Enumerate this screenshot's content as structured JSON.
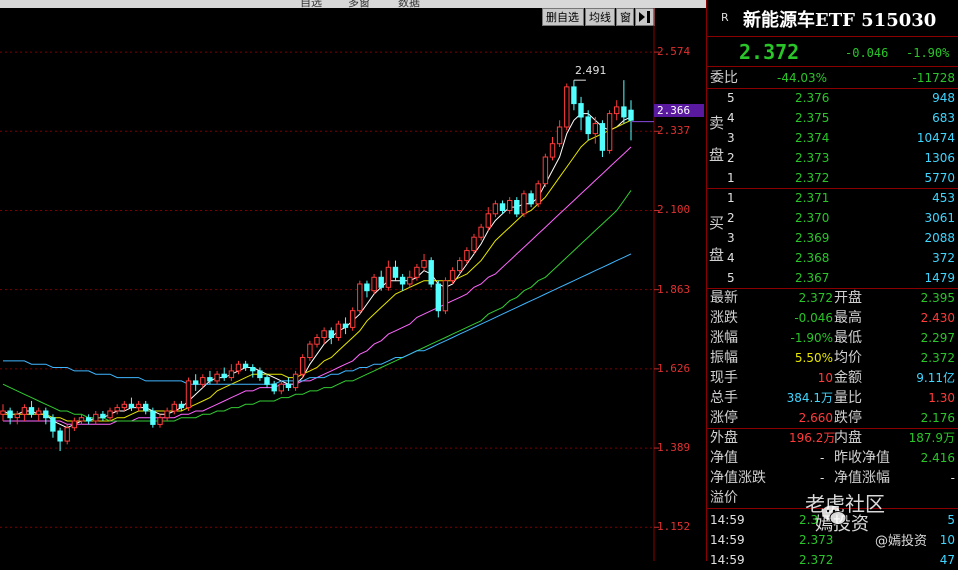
{
  "toolbar": {
    "delete_label": "删自选",
    "ma_label": "均线",
    "window_label": "窗",
    "collapse_icon": "collapse-right-icon",
    "top_menu": [
      "自选",
      "多窗",
      "数据"
    ]
  },
  "chart_data": {
    "type": "candlestick",
    "title": "",
    "ylabel": "",
    "ylim": [
      1.06,
      2.7
    ],
    "y_ticks": [
      "2.574",
      "2.337",
      "2.100",
      "1.863",
      "1.626",
      "1.389",
      "1.152"
    ],
    "y_tick_values": [
      2.574,
      2.337,
      2.1,
      1.863,
      1.626,
      1.389,
      1.152
    ],
    "current_price_label": "2.366",
    "current_price": 2.366,
    "high_label": "2.491",
    "high_value": 2.491,
    "candles": [
      {
        "o": 1.49,
        "c": 1.5,
        "h": 1.52,
        "l": 1.47
      },
      {
        "o": 1.5,
        "c": 1.48,
        "h": 1.51,
        "l": 1.46
      },
      {
        "o": 1.48,
        "c": 1.49,
        "h": 1.5,
        "l": 1.46
      },
      {
        "o": 1.49,
        "c": 1.51,
        "h": 1.52,
        "l": 1.47
      },
      {
        "o": 1.51,
        "c": 1.49,
        "h": 1.53,
        "l": 1.48
      },
      {
        "o": 1.49,
        "c": 1.5,
        "h": 1.51,
        "l": 1.47
      },
      {
        "o": 1.5,
        "c": 1.48,
        "h": 1.51,
        "l": 1.46
      },
      {
        "o": 1.48,
        "c": 1.44,
        "h": 1.49,
        "l": 1.42
      },
      {
        "o": 1.44,
        "c": 1.41,
        "h": 1.45,
        "l": 1.38
      },
      {
        "o": 1.41,
        "c": 1.45,
        "h": 1.46,
        "l": 1.4
      },
      {
        "o": 1.45,
        "c": 1.47,
        "h": 1.48,
        "l": 1.44
      },
      {
        "o": 1.47,
        "c": 1.48,
        "h": 1.49,
        "l": 1.46
      },
      {
        "o": 1.48,
        "c": 1.47,
        "h": 1.49,
        "l": 1.46
      },
      {
        "o": 1.47,
        "c": 1.49,
        "h": 1.5,
        "l": 1.46
      },
      {
        "o": 1.49,
        "c": 1.48,
        "h": 1.5,
        "l": 1.47
      },
      {
        "o": 1.48,
        "c": 1.5,
        "h": 1.51,
        "l": 1.47
      },
      {
        "o": 1.5,
        "c": 1.51,
        "h": 1.52,
        "l": 1.49
      },
      {
        "o": 1.51,
        "c": 1.52,
        "h": 1.53,
        "l": 1.5
      },
      {
        "o": 1.52,
        "c": 1.51,
        "h": 1.54,
        "l": 1.5
      },
      {
        "o": 1.51,
        "c": 1.52,
        "h": 1.53,
        "l": 1.5
      },
      {
        "o": 1.52,
        "c": 1.5,
        "h": 1.53,
        "l": 1.49
      },
      {
        "o": 1.5,
        "c": 1.46,
        "h": 1.51,
        "l": 1.45
      },
      {
        "o": 1.46,
        "c": 1.48,
        "h": 1.49,
        "l": 1.45
      },
      {
        "o": 1.48,
        "c": 1.5,
        "h": 1.51,
        "l": 1.47
      },
      {
        "o": 1.5,
        "c": 1.52,
        "h": 1.53,
        "l": 1.49
      },
      {
        "o": 1.52,
        "c": 1.51,
        "h": 1.53,
        "l": 1.5
      },
      {
        "o": 1.51,
        "c": 1.59,
        "h": 1.6,
        "l": 1.5
      },
      {
        "o": 1.59,
        "c": 1.58,
        "h": 1.61,
        "l": 1.56
      },
      {
        "o": 1.58,
        "c": 1.6,
        "h": 1.61,
        "l": 1.57
      },
      {
        "o": 1.6,
        "c": 1.59,
        "h": 1.62,
        "l": 1.58
      },
      {
        "o": 1.59,
        "c": 1.61,
        "h": 1.62,
        "l": 1.58
      },
      {
        "o": 1.61,
        "c": 1.6,
        "h": 1.63,
        "l": 1.59
      },
      {
        "o": 1.6,
        "c": 1.62,
        "h": 1.64,
        "l": 1.59
      },
      {
        "o": 1.62,
        "c": 1.64,
        "h": 1.65,
        "l": 1.61
      },
      {
        "o": 1.64,
        "c": 1.63,
        "h": 1.65,
        "l": 1.62
      },
      {
        "o": 1.63,
        "c": 1.62,
        "h": 1.64,
        "l": 1.6
      },
      {
        "o": 1.62,
        "c": 1.6,
        "h": 1.63,
        "l": 1.59
      },
      {
        "o": 1.6,
        "c": 1.58,
        "h": 1.61,
        "l": 1.57
      },
      {
        "o": 1.58,
        "c": 1.56,
        "h": 1.59,
        "l": 1.55
      },
      {
        "o": 1.56,
        "c": 1.58,
        "h": 1.59,
        "l": 1.55
      },
      {
        "o": 1.58,
        "c": 1.57,
        "h": 1.6,
        "l": 1.56
      },
      {
        "o": 1.57,
        "c": 1.61,
        "h": 1.62,
        "l": 1.56
      },
      {
        "o": 1.61,
        "c": 1.66,
        "h": 1.67,
        "l": 1.6
      },
      {
        "o": 1.66,
        "c": 1.7,
        "h": 1.71,
        "l": 1.65
      },
      {
        "o": 1.7,
        "c": 1.72,
        "h": 1.73,
        "l": 1.69
      },
      {
        "o": 1.72,
        "c": 1.74,
        "h": 1.75,
        "l": 1.7
      },
      {
        "o": 1.74,
        "c": 1.72,
        "h": 1.75,
        "l": 1.7
      },
      {
        "o": 1.72,
        "c": 1.76,
        "h": 1.77,
        "l": 1.71
      },
      {
        "o": 1.76,
        "c": 1.75,
        "h": 1.78,
        "l": 1.73
      },
      {
        "o": 1.75,
        "c": 1.8,
        "h": 1.81,
        "l": 1.74
      },
      {
        "o": 1.8,
        "c": 1.88,
        "h": 1.89,
        "l": 1.79
      },
      {
        "o": 1.88,
        "c": 1.86,
        "h": 1.89,
        "l": 1.84
      },
      {
        "o": 1.86,
        "c": 1.9,
        "h": 1.91,
        "l": 1.85
      },
      {
        "o": 1.9,
        "c": 1.87,
        "h": 1.92,
        "l": 1.86
      },
      {
        "o": 1.87,
        "c": 1.93,
        "h": 1.95,
        "l": 1.86
      },
      {
        "o": 1.93,
        "c": 1.9,
        "h": 1.95,
        "l": 1.89
      },
      {
        "o": 1.9,
        "c": 1.88,
        "h": 1.91,
        "l": 1.86
      },
      {
        "o": 1.88,
        "c": 1.9,
        "h": 1.92,
        "l": 1.87
      },
      {
        "o": 1.9,
        "c": 1.93,
        "h": 1.94,
        "l": 1.89
      },
      {
        "o": 1.93,
        "c": 1.95,
        "h": 1.97,
        "l": 1.92
      },
      {
        "o": 1.95,
        "c": 1.88,
        "h": 1.96,
        "l": 1.87
      },
      {
        "o": 1.88,
        "c": 1.8,
        "h": 1.89,
        "l": 1.78
      },
      {
        "o": 1.8,
        "c": 1.89,
        "h": 1.9,
        "l": 1.79
      },
      {
        "o": 1.89,
        "c": 1.92,
        "h": 1.93,
        "l": 1.88
      },
      {
        "o": 1.92,
        "c": 1.95,
        "h": 1.96,
        "l": 1.91
      },
      {
        "o": 1.95,
        "c": 1.98,
        "h": 1.99,
        "l": 1.94
      },
      {
        "o": 1.98,
        "c": 2.02,
        "h": 2.03,
        "l": 1.97
      },
      {
        "o": 2.02,
        "c": 2.05,
        "h": 2.06,
        "l": 2.01
      },
      {
        "o": 2.05,
        "c": 2.09,
        "h": 2.11,
        "l": 2.04
      },
      {
        "o": 2.09,
        "c": 2.12,
        "h": 2.13,
        "l": 2.08
      },
      {
        "o": 2.12,
        "c": 2.1,
        "h": 2.13,
        "l": 2.09
      },
      {
        "o": 2.1,
        "c": 2.13,
        "h": 2.14,
        "l": 2.09
      },
      {
        "o": 2.13,
        "c": 2.09,
        "h": 2.14,
        "l": 2.08
      },
      {
        "o": 2.09,
        "c": 2.15,
        "h": 2.16,
        "l": 2.08
      },
      {
        "o": 2.15,
        "c": 2.12,
        "h": 2.16,
        "l": 2.11
      },
      {
        "o": 2.12,
        "c": 2.18,
        "h": 2.19,
        "l": 2.11
      },
      {
        "o": 2.18,
        "c": 2.26,
        "h": 2.27,
        "l": 2.17
      },
      {
        "o": 2.26,
        "c": 2.3,
        "h": 2.32,
        "l": 2.25
      },
      {
        "o": 2.3,
        "c": 2.35,
        "h": 2.37,
        "l": 2.29
      },
      {
        "o": 2.35,
        "c": 2.47,
        "h": 2.48,
        "l": 2.34
      },
      {
        "o": 2.47,
        "c": 2.42,
        "h": 2.49,
        "l": 2.4
      },
      {
        "o": 2.42,
        "c": 2.38,
        "h": 2.44,
        "l": 2.34
      },
      {
        "o": 2.38,
        "c": 2.33,
        "h": 2.4,
        "l": 2.31
      },
      {
        "o": 2.33,
        "c": 2.36,
        "h": 2.38,
        "l": 2.3
      },
      {
        "o": 2.36,
        "c": 2.28,
        "h": 2.37,
        "l": 2.26
      },
      {
        "o": 2.28,
        "c": 2.39,
        "h": 2.4,
        "l": 2.27
      },
      {
        "o": 2.39,
        "c": 2.41,
        "h": 2.43,
        "l": 2.37
      },
      {
        "o": 2.41,
        "c": 2.38,
        "h": 2.49,
        "l": 2.36
      },
      {
        "o": 2.4,
        "c": 2.37,
        "h": 2.43,
        "l": 2.31
      }
    ],
    "ma_lines": [
      {
        "color": "#ffffff",
        "values": [
          1.5,
          1.49,
          1.49,
          1.5,
          1.5,
          1.49,
          1.49,
          1.47,
          1.46,
          1.45,
          1.46,
          1.47,
          1.47,
          1.48,
          1.48,
          1.49,
          1.5,
          1.5,
          1.51,
          1.51,
          1.51,
          1.5,
          1.49,
          1.49,
          1.5,
          1.51,
          1.53,
          1.55,
          1.57,
          1.59,
          1.6,
          1.6,
          1.61,
          1.62,
          1.63,
          1.63,
          1.62,
          1.61,
          1.6,
          1.59,
          1.58,
          1.58,
          1.6,
          1.64,
          1.67,
          1.7,
          1.72,
          1.74,
          1.75,
          1.77,
          1.79,
          1.82,
          1.85,
          1.87,
          1.89,
          1.89,
          1.89,
          1.89,
          1.9,
          1.92,
          1.91,
          1.88,
          1.87,
          1.88,
          1.91,
          1.94,
          1.97,
          2.0,
          2.04,
          2.07,
          2.09,
          2.11,
          2.11,
          2.12,
          2.12,
          2.14,
          2.18,
          2.22,
          2.26,
          2.33,
          2.37,
          2.39,
          2.39,
          2.37,
          2.35,
          2.34,
          2.35,
          2.37,
          2.38
        ]
      },
      {
        "color": "#e6e600",
        "values": [
          1.49,
          1.49,
          1.49,
          1.49,
          1.49,
          1.49,
          1.49,
          1.48,
          1.48,
          1.47,
          1.47,
          1.47,
          1.47,
          1.47,
          1.47,
          1.47,
          1.48,
          1.48,
          1.49,
          1.5,
          1.5,
          1.5,
          1.5,
          1.5,
          1.5,
          1.5,
          1.51,
          1.52,
          1.53,
          1.54,
          1.56,
          1.57,
          1.58,
          1.59,
          1.6,
          1.61,
          1.61,
          1.61,
          1.61,
          1.61,
          1.6,
          1.6,
          1.61,
          1.62,
          1.63,
          1.65,
          1.66,
          1.68,
          1.7,
          1.72,
          1.74,
          1.77,
          1.79,
          1.81,
          1.83,
          1.85,
          1.86,
          1.87,
          1.88,
          1.89,
          1.89,
          1.89,
          1.89,
          1.89,
          1.9,
          1.91,
          1.93,
          1.95,
          1.98,
          2.01,
          2.03,
          2.05,
          2.07,
          2.09,
          2.1,
          2.12,
          2.14,
          2.17,
          2.2,
          2.23,
          2.26,
          2.29,
          2.31,
          2.32,
          2.33,
          2.34,
          2.35,
          2.36,
          2.37
        ]
      },
      {
        "color": "#ff66ff",
        "values": [
          1.47,
          1.47,
          1.47,
          1.47,
          1.47,
          1.47,
          1.47,
          1.47,
          1.47,
          1.46,
          1.46,
          1.46,
          1.46,
          1.46,
          1.46,
          1.46,
          1.47,
          1.47,
          1.47,
          1.48,
          1.48,
          1.48,
          1.48,
          1.48,
          1.48,
          1.49,
          1.49,
          1.5,
          1.5,
          1.51,
          1.52,
          1.53,
          1.54,
          1.55,
          1.56,
          1.56,
          1.57,
          1.57,
          1.57,
          1.58,
          1.58,
          1.58,
          1.59,
          1.59,
          1.6,
          1.61,
          1.62,
          1.63,
          1.64,
          1.65,
          1.67,
          1.68,
          1.7,
          1.71,
          1.73,
          1.74,
          1.75,
          1.76,
          1.78,
          1.79,
          1.8,
          1.81,
          1.82,
          1.83,
          1.84,
          1.85,
          1.87,
          1.88,
          1.9,
          1.91,
          1.93,
          1.95,
          1.97,
          1.99,
          2.01,
          2.03,
          2.05,
          2.07,
          2.09,
          2.11,
          2.13,
          2.15,
          2.17,
          2.19,
          2.21,
          2.23,
          2.25,
          2.27,
          2.29
        ]
      },
      {
        "color": "#33cc33",
        "values": [
          1.58,
          1.57,
          1.56,
          1.55,
          1.54,
          1.53,
          1.52,
          1.51,
          1.5,
          1.5,
          1.49,
          1.49,
          1.48,
          1.48,
          1.48,
          1.47,
          1.47,
          1.47,
          1.47,
          1.47,
          1.47,
          1.47,
          1.47,
          1.47,
          1.47,
          1.48,
          1.48,
          1.48,
          1.49,
          1.49,
          1.5,
          1.5,
          1.51,
          1.51,
          1.52,
          1.52,
          1.53,
          1.53,
          1.53,
          1.54,
          1.54,
          1.55,
          1.55,
          1.56,
          1.56,
          1.57,
          1.57,
          1.58,
          1.59,
          1.59,
          1.6,
          1.61,
          1.62,
          1.63,
          1.64,
          1.65,
          1.66,
          1.67,
          1.68,
          1.69,
          1.7,
          1.71,
          1.72,
          1.73,
          1.74,
          1.75,
          1.76,
          1.77,
          1.79,
          1.8,
          1.81,
          1.83,
          1.84,
          1.86,
          1.87,
          1.89,
          1.9,
          1.92,
          1.94,
          1.96,
          1.98,
          2.0,
          2.02,
          2.04,
          2.06,
          2.08,
          2.1,
          2.13,
          2.16
        ]
      },
      {
        "color": "#3fb6ff",
        "values": [
          1.65,
          1.65,
          1.65,
          1.65,
          1.64,
          1.64,
          1.64,
          1.63,
          1.63,
          1.63,
          1.62,
          1.62,
          1.62,
          1.61,
          1.61,
          1.61,
          1.6,
          1.6,
          1.6,
          1.6,
          1.59,
          1.59,
          1.59,
          1.59,
          1.59,
          1.59,
          1.58,
          1.58,
          1.58,
          1.58,
          1.58,
          1.58,
          1.58,
          1.58,
          1.58,
          1.58,
          1.58,
          1.58,
          1.58,
          1.59,
          1.59,
          1.59,
          1.59,
          1.6,
          1.6,
          1.6,
          1.61,
          1.61,
          1.62,
          1.62,
          1.63,
          1.63,
          1.64,
          1.64,
          1.65,
          1.66,
          1.66,
          1.67,
          1.68,
          1.68,
          1.69,
          1.7,
          1.71,
          1.72,
          1.73,
          1.74,
          1.75,
          1.76,
          1.77,
          1.78,
          1.79,
          1.8,
          1.81,
          1.82,
          1.83,
          1.84,
          1.85,
          1.86,
          1.87,
          1.88,
          1.89,
          1.9,
          1.91,
          1.92,
          1.93,
          1.94,
          1.95,
          1.96,
          1.97
        ]
      }
    ]
  },
  "quote": {
    "badge": "R",
    "title": "新能源车ETF 515030",
    "price": "2.372",
    "change": "-0.046",
    "change_pct": "-1.90%",
    "weibi_label": "委比",
    "weibi_pct": "-44.03%",
    "weibi_diff": "-11728",
    "sell_label_1": "卖",
    "sell_label_2": "盘",
    "buy_label_1": "买",
    "buy_label_2": "盘",
    "asks": [
      {
        "lvl": "5",
        "price": "2.376",
        "vol": "948"
      },
      {
        "lvl": "4",
        "price": "2.375",
        "vol": "683"
      },
      {
        "lvl": "3",
        "price": "2.374",
        "vol": "10474"
      },
      {
        "lvl": "2",
        "price": "2.373",
        "vol": "1306"
      },
      {
        "lvl": "1",
        "price": "2.372",
        "vol": "5770"
      }
    ],
    "bids": [
      {
        "lvl": "1",
        "price": "2.371",
        "vol": "453"
      },
      {
        "lvl": "2",
        "price": "2.370",
        "vol": "3061"
      },
      {
        "lvl": "3",
        "price": "2.369",
        "vol": "2088"
      },
      {
        "lvl": "4",
        "price": "2.368",
        "vol": "372"
      },
      {
        "lvl": "5",
        "price": "2.367",
        "vol": "1479"
      }
    ],
    "stats": [
      {
        "l1": "最新",
        "v1": "2.372",
        "c1": "g",
        "l2": "开盘",
        "v2": "2.395",
        "c2": "g"
      },
      {
        "l1": "涨跌",
        "v1": "-0.046",
        "c1": "g",
        "l2": "最高",
        "v2": "2.430",
        "c2": "r"
      },
      {
        "l1": "涨幅",
        "v1": "-1.90%",
        "c1": "g",
        "l2": "最低",
        "v2": "2.297",
        "c2": "g"
      },
      {
        "l1": "振幅",
        "v1": "5.50%",
        "c1": "y",
        "l2": "均价",
        "v2": "2.372",
        "c2": "g"
      },
      {
        "l1": "现手",
        "v1": "10",
        "c1": "r",
        "l2": "金额",
        "v2": "9.11亿",
        "c2": "c"
      },
      {
        "l1": "总手",
        "v1": "384.1万",
        "c1": "c",
        "l2": "量比",
        "v2": "1.30",
        "c2": "r"
      },
      {
        "l1": "涨停",
        "v1": "2.660",
        "c1": "r",
        "l2": "跌停",
        "v2": "2.176",
        "c2": "g"
      }
    ],
    "outer_label": "外盘",
    "outer_val": "196.2万",
    "inner_label": "内盘",
    "inner_val": "187.9万",
    "nav_label": "净值",
    "nav_val": "-",
    "prev_nav_label": "昨收净值",
    "prev_nav_val": "2.416",
    "nav_chg_label": "净值涨跌",
    "nav_chg_val": "-",
    "nav_chg_pct_label": "净值涨幅",
    "nav_chg_pct_val": "-",
    "premium_label": "溢价",
    "premium_val": "-",
    "ticks": [
      {
        "time": "14:59",
        "price": "2.3",
        "vol": "5"
      },
      {
        "time": "14:59",
        "price": "2.373",
        "vol": "10"
      },
      {
        "time": "14:59",
        "price": "2.372",
        "vol": "47"
      }
    ]
  },
  "watermark": {
    "line1": "老虎社区",
    "line2": "嫣投资",
    "line3": "@嫣投资"
  }
}
